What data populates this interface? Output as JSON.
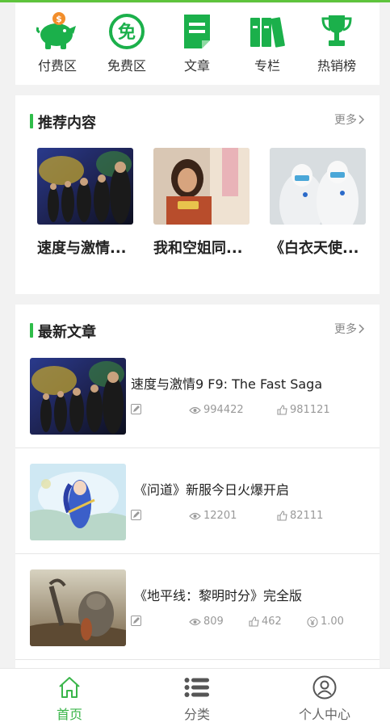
{
  "quick_nav": [
    {
      "label": "付费区",
      "icon": "piggy-bank-icon"
    },
    {
      "label": "免费区",
      "icon": "free-badge-icon"
    },
    {
      "label": "文章",
      "icon": "document-icon"
    },
    {
      "label": "专栏",
      "icon": "books-icon"
    },
    {
      "label": "热销榜",
      "icon": "trophy-icon"
    }
  ],
  "free_badge_char": "免",
  "coin_char": "$",
  "recommend": {
    "title": "推荐内容",
    "more": "更多",
    "items": [
      {
        "title": "速度与激情..."
      },
      {
        "title": "我和空姐同..."
      },
      {
        "title": "《白衣天使..."
      }
    ]
  },
  "latest": {
    "title": "最新文章",
    "more": "更多",
    "articles": [
      {
        "title": "速度与激情9 F9: The Fast Saga",
        "views": "994422",
        "likes": "981121"
      },
      {
        "title": "《问道》新服今日火爆开启",
        "views": "12201",
        "likes": "82111"
      },
      {
        "title": "《地平线：黎明时分》完全版",
        "views": "809",
        "likes": "462",
        "price": "1.00"
      }
    ]
  },
  "tabbar": [
    {
      "label": "首页",
      "icon": "home-icon",
      "active": true
    },
    {
      "label": "分类",
      "icon": "list-icon",
      "active": false
    },
    {
      "label": "个人中心",
      "icon": "user-icon",
      "active": false
    }
  ],
  "colors": {
    "accent": "#2fbd4a",
    "tab_active": "#3ab54a",
    "icon_green": "#1bb04b"
  }
}
